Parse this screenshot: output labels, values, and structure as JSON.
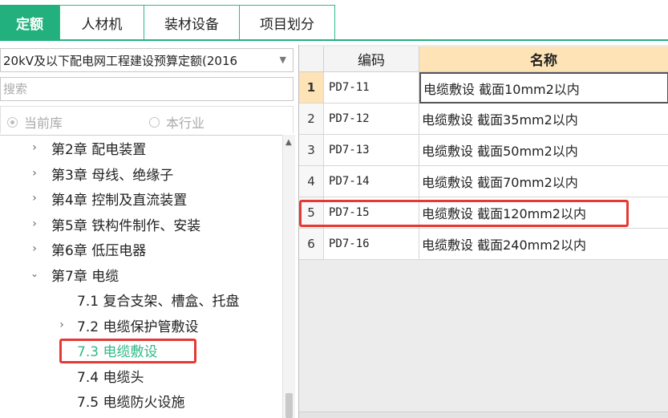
{
  "tabs": [
    {
      "label": "定额",
      "active": true
    },
    {
      "label": "人材机",
      "active": false
    },
    {
      "label": "装材设备",
      "active": false
    },
    {
      "label": "项目划分",
      "active": false
    }
  ],
  "library_select": {
    "value": "20kV及以下配电网工程建设预算定额(2016"
  },
  "search": {
    "placeholder": "搜索"
  },
  "scope": {
    "current_lib": "当前库",
    "industry": "本行业",
    "selected": "current_lib"
  },
  "tree": {
    "items": [
      {
        "label": "第2章 配电装置",
        "level": 0,
        "expander": "collapsed"
      },
      {
        "label": "第3章 母线、绝缘子",
        "level": 0,
        "expander": "collapsed"
      },
      {
        "label": "第4章 控制及直流装置",
        "level": 0,
        "expander": "collapsed"
      },
      {
        "label": "第5章 铁构件制作、安装",
        "level": 0,
        "expander": "collapsed"
      },
      {
        "label": "第6章 低压电器",
        "level": 0,
        "expander": "collapsed"
      },
      {
        "label": "第7章 电缆",
        "level": 0,
        "expander": "expanded"
      },
      {
        "label": "7.1 复合支架、槽盒、托盘",
        "level": 1,
        "expander": "none"
      },
      {
        "label": "7.2 电缆保护管敷设",
        "level": 1,
        "expander": "collapsed"
      },
      {
        "label": "7.3 电缆敷设",
        "level": 1,
        "expander": "none",
        "selected": true
      },
      {
        "label": "7.4 电缆头",
        "level": 1,
        "expander": "none"
      },
      {
        "label": "7.5 电缆防火设施",
        "level": 1,
        "expander": "none"
      }
    ]
  },
  "grid": {
    "headers": {
      "index": "",
      "code": "编码",
      "name": "名称"
    },
    "rows": [
      {
        "index": "1",
        "code": "PD7-11",
        "name": "电缆敷设 截面10mm2以内",
        "active": true
      },
      {
        "index": "2",
        "code": "PD7-12",
        "name": "电缆敷设 截面35mm2以内"
      },
      {
        "index": "3",
        "code": "PD7-13",
        "name": "电缆敷设 截面50mm2以内"
      },
      {
        "index": "4",
        "code": "PD7-14",
        "name": "电缆敷设 截面70mm2以内"
      },
      {
        "index": "5",
        "code": "PD7-15",
        "name": "电缆敷设 截面120mm2以内",
        "highlighted": true
      },
      {
        "index": "6",
        "code": "PD7-16",
        "name": "电缆敷设 截面240mm2以内"
      }
    ]
  },
  "colors": {
    "accent": "#22b17e",
    "highlight_box": "#e53935",
    "selected_text": "#2fb98a",
    "header_name_bg": "#fde3b5"
  }
}
